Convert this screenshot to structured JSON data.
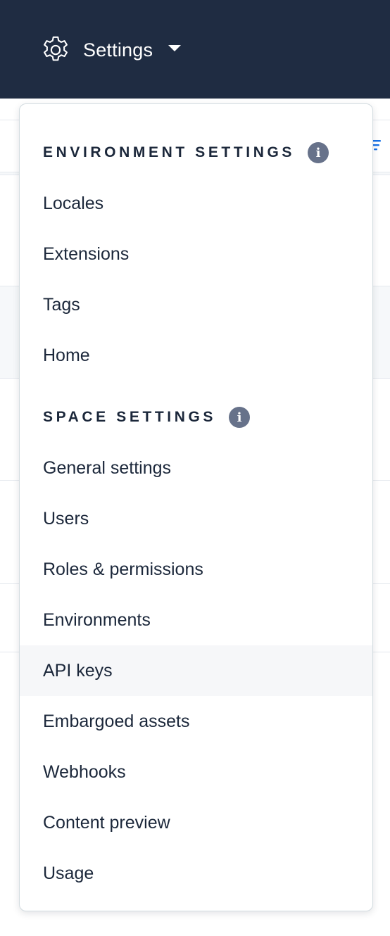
{
  "header": {
    "settings_label": "Settings",
    "icon": "gear-icon",
    "caret_icon": "caret-down-icon"
  },
  "colors": {
    "topbar": "#1f2c42",
    "text": "#1b273a",
    "info_icon": "#67728a",
    "hover_row": "#f6f7f9",
    "accent": "#1872e6"
  },
  "menu": {
    "environment_settings": {
      "title": "ENVIRONMENT SETTINGS",
      "info_glyph": "i",
      "items": [
        {
          "label": "Locales"
        },
        {
          "label": "Extensions"
        },
        {
          "label": "Tags"
        },
        {
          "label": "Home"
        }
      ]
    },
    "space_settings": {
      "title": "SPACE SETTINGS",
      "info_glyph": "i",
      "items": [
        {
          "label": "General settings"
        },
        {
          "label": "Users"
        },
        {
          "label": "Roles & permissions"
        },
        {
          "label": "Environments"
        },
        {
          "label": "API keys"
        },
        {
          "label": "Embargoed assets"
        },
        {
          "label": "Webhooks"
        },
        {
          "label": "Content preview"
        },
        {
          "label": "Usage"
        }
      ]
    }
  }
}
